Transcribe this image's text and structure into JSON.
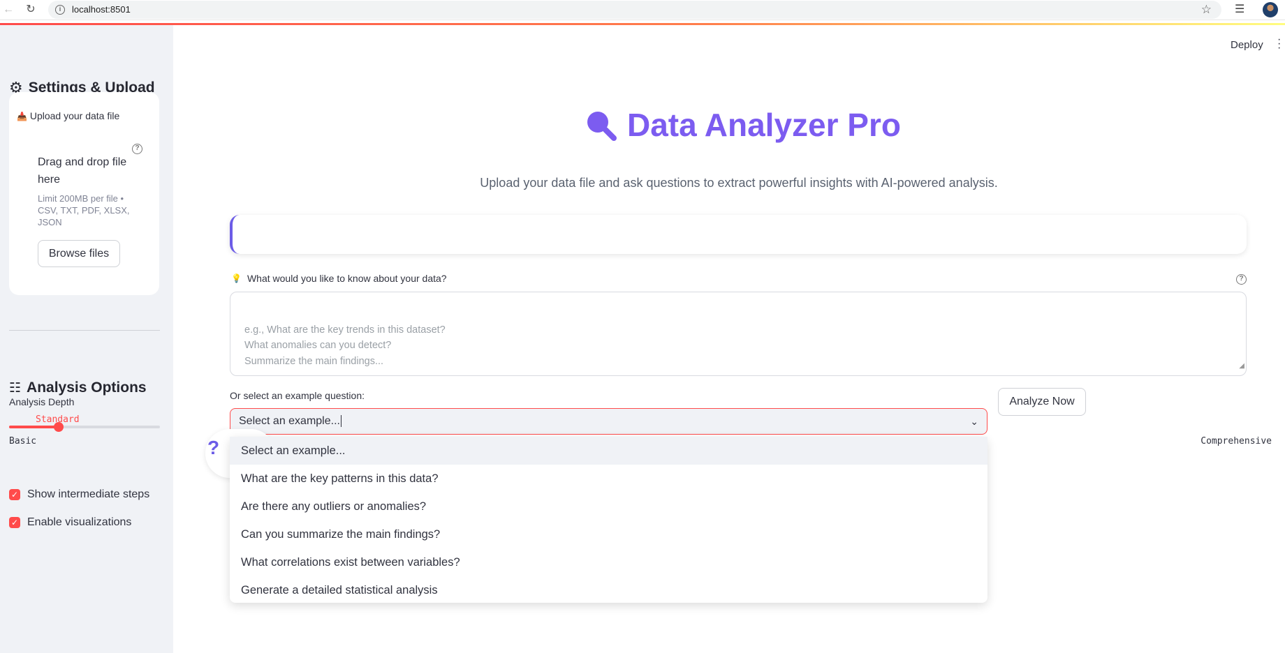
{
  "browser": {
    "url": "localhost:8501"
  },
  "sidebar": {
    "settings_header": "Settings & Upload",
    "upload": {
      "label": "Upload your data file",
      "drop_title": "Drag and drop file here",
      "limit_text": "Limit 200MB per file • CSV, TXT, PDF, XLSX, JSON",
      "browse_label": "Browse files"
    },
    "analysis_header": "Analysis Options",
    "depth": {
      "label": "Analysis Depth",
      "value": "Standard",
      "min_label": "Basic",
      "max_label": "Comprehensive",
      "level": 0.33
    },
    "checkboxes": [
      {
        "label": "Show intermediate steps",
        "checked": true
      },
      {
        "label": "Enable visualizations",
        "checked": true
      }
    ]
  },
  "header": {
    "deploy_label": "Deploy"
  },
  "main": {
    "title": "Data Analyzer Pro",
    "subtitle": "Upload your data file and ask questions to extract powerful insights with AI-powered analysis.",
    "question_label": "What would you like to know about your data?",
    "question_placeholder": "e.g., What are the key trends in this dataset?\nWhat anomalies can you detect?\nSummarize the main findings...",
    "example_label": "Or select an example question:",
    "select_value": "Select an example...",
    "analyze_label": "Analyze Now",
    "options": [
      "Select an example...",
      "What are the key patterns in this data?",
      "Are there any outliers or anomalies?",
      "Can you summarize the main findings?",
      "What correlations exist between variables?",
      "Generate a detailed statistical analysis"
    ]
  },
  "colors": {
    "accent": "#ff4b4b",
    "brand": "#7c5cf0",
    "sidebar_bg": "#f0f2f6"
  }
}
